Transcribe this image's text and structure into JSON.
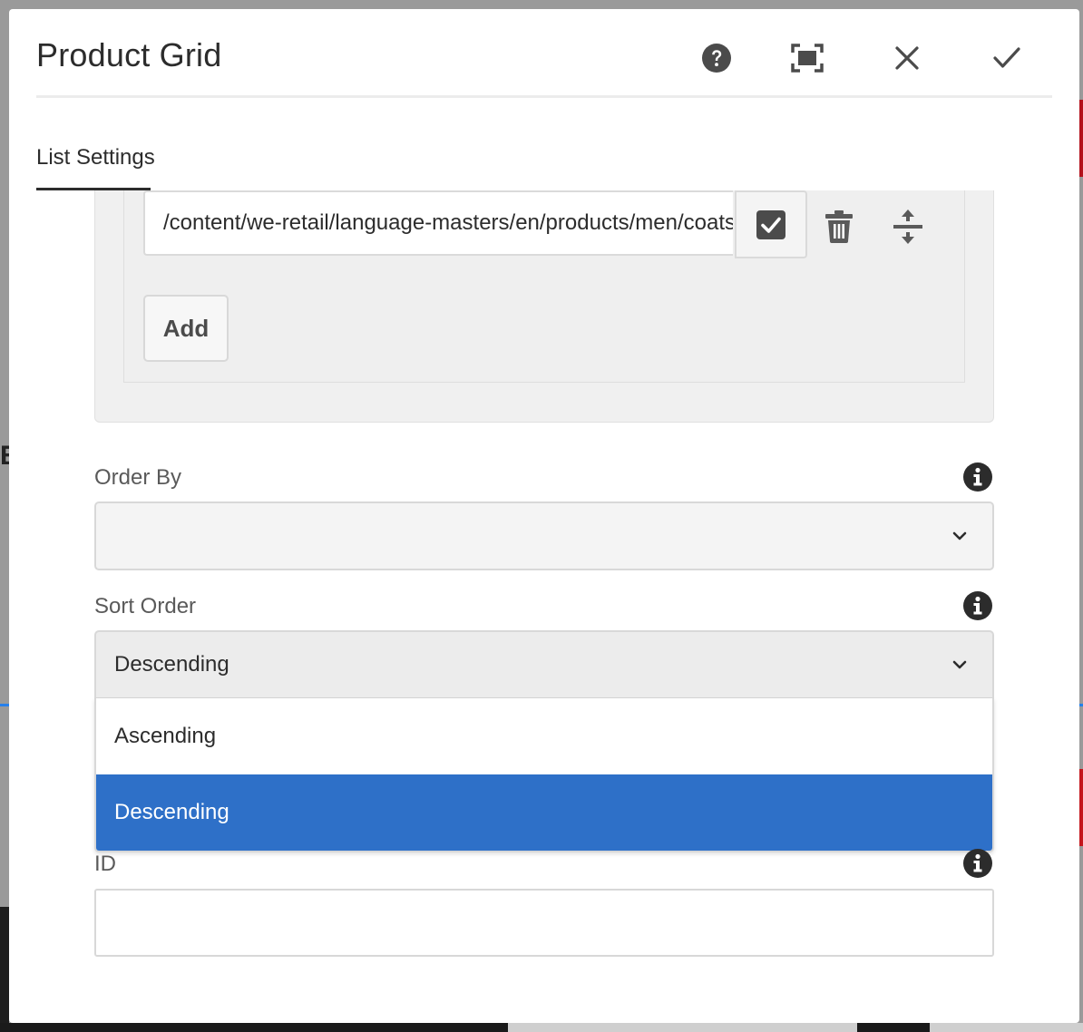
{
  "dialog": {
    "title": "Product Grid",
    "tab_label": "List Settings"
  },
  "header_icons": {
    "help": "help-icon",
    "fullscreen": "fullscreen-icon",
    "close": "close-icon",
    "done": "checkmark-icon"
  },
  "multifield": {
    "path_value": "/content/we-retail/language-masters/en/products/men/coats",
    "add_label": "Add"
  },
  "order_by": {
    "label": "Order By",
    "value": ""
  },
  "sort_order": {
    "label": "Sort Order",
    "value": "Descending",
    "options": [
      "Ascending",
      "Descending"
    ],
    "selected_index": 1
  },
  "id_field": {
    "label": "ID",
    "value": ""
  },
  "colors": {
    "selected_option": "#2e70c8",
    "text": "#2c2c2c",
    "label": "#5a5a5a"
  }
}
